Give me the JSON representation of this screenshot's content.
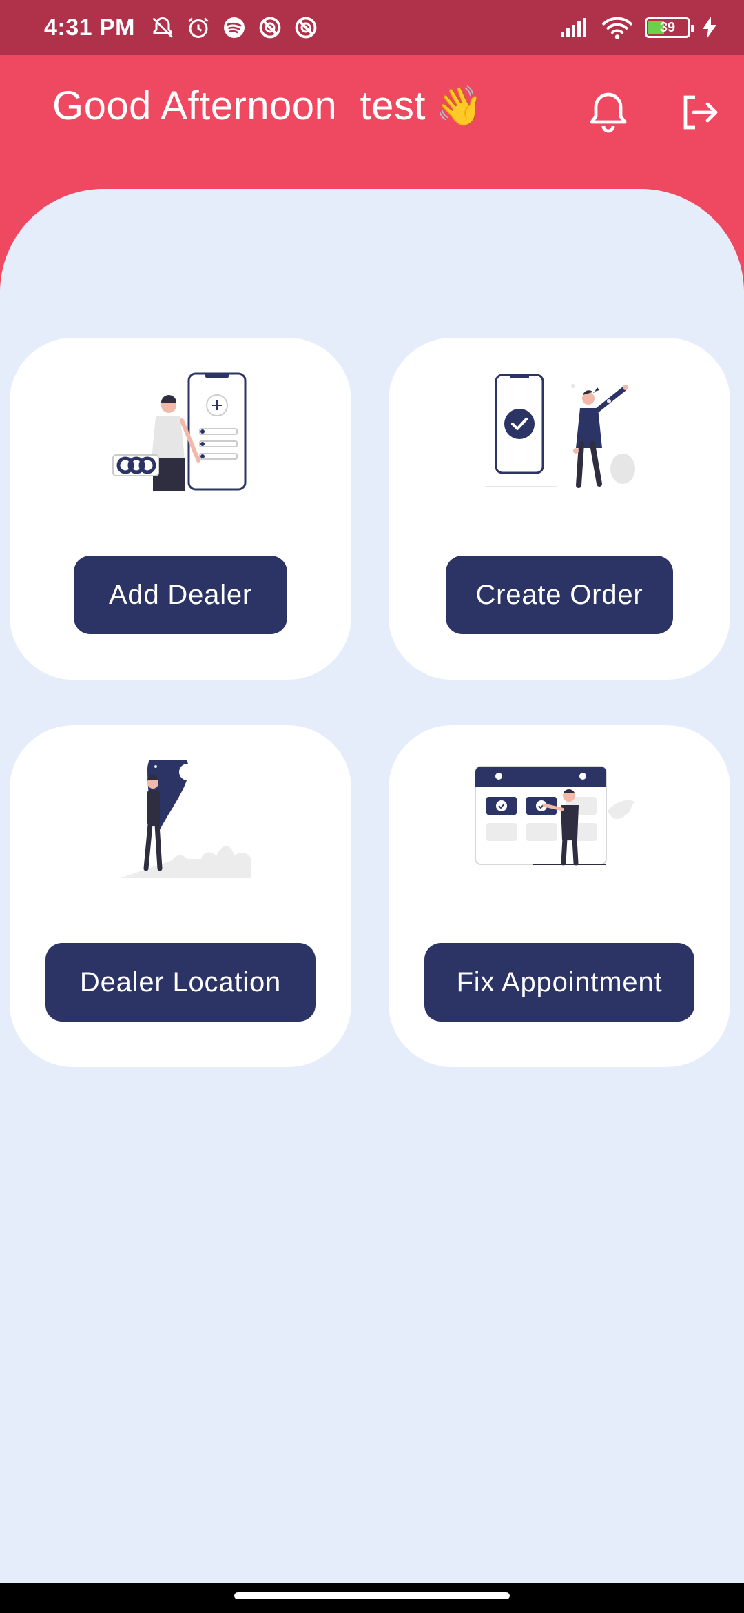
{
  "status_bar": {
    "time": "4:31 PM",
    "icons_left": [
      "muted-bell-icon",
      "alarm-icon",
      "spotify-icon",
      "blocked-app-icon",
      "blocked-app-icon"
    ],
    "icons_right": [
      "signal-icon",
      "wifi-icon",
      "battery-icon",
      "charging-icon"
    ],
    "battery_level": "39"
  },
  "header": {
    "greeting": "Good Afternoon  test",
    "greeting_emoji": "👋",
    "bell_icon": "bell-icon",
    "logout_icon": "logout-icon"
  },
  "cards": [
    {
      "id": "add-dealer",
      "label": "Add Dealer",
      "illustration": "person-with-phone-form"
    },
    {
      "id": "create-order",
      "label": "Create Order",
      "illustration": "phone-checkmark-celebration"
    },
    {
      "id": "dealer-location",
      "label": "Dealer Location",
      "illustration": "person-with-map-pin"
    },
    {
      "id": "fix-appointment",
      "label": "Fix Appointment",
      "illustration": "person-at-calendar"
    }
  ],
  "colors": {
    "status_bar": "#b0324a",
    "header": "#ee4961",
    "background": "#e6edfa",
    "card": "#ffffff",
    "button": "#2c3466"
  }
}
